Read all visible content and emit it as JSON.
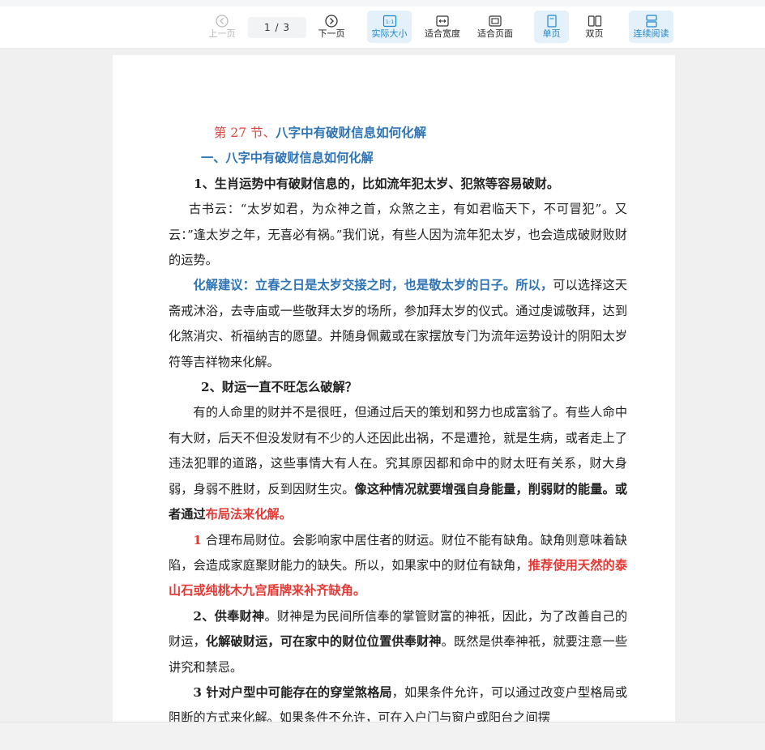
{
  "toolbar": {
    "prev": "上一页",
    "page_current": "1",
    "page_total": "/ 3",
    "next": "下一页",
    "actual_size": "实际大小",
    "fit_width": "适合宽度",
    "fit_page": "适合页面",
    "single": "单页",
    "double": "双页",
    "continuous": "连续阅读",
    "actual_icon_text": "1:1",
    "accent_color": "#1f86c9"
  },
  "doc": {
    "title_num": "第 27 节、",
    "title_rest": "八字中有破财信息如何化解",
    "h1": "一、八字中有破财信息如何化解",
    "h_shengxiao": "1、生肖运势中有破财信息的，比如流年犯太岁、犯煞等容易破财。",
    "p1": "古书云：“太岁如君，为众神之首，众煞之主，有如君临天下，不可冒犯”。又云：”逢太岁之年，无喜必有祸。”我们说，有些人因为流年犯太岁，也会造成破财败财的运势。",
    "p2_blue": "化解建议：立春之日是太岁交接之时，也是敬太岁的日子。所以，",
    "p2_rest": "可以选择这天斋戒沐浴，去寺庙或一些敬拜太岁的场所，参加拜太岁的仪式。通过虔诚敬拜，达到化煞消灾、祈福纳吉的愿望。并随身佩戴或在家摆放专门为流年运势设计的阴阳太岁符等吉祥物来化解。",
    "h2": "2、财运一直不旺怎么破解？",
    "p3": "有的人命里的财并不是很旺，但通过后天的策划和努力也成富翁了。有些人命中有大财，后天不但没发财有不少的人还因此出祸，不是遭抢，就是生病，或者走上了违法犯罪的道路，这些事情大有人在。究其原因都和命中的财太旺有关系，财大身弱，身弱不胜财，反到因财生灾。",
    "p3_bold": "像这种情况就要增强自身能量，削弱财的能量。或者通过",
    "p3_red": "布局法来化解。",
    "p4_num": "1",
    "p4_text": " 合理布局财位。会影响家中居住者的财运。财位不能有缺角。缺角则意味着缺陷，会造成家庭聚财能力的缺失。所以，如果家中的财位有缺角，",
    "p4_red": "推荐使用天然的泰山石或纯桃木九宫盾牌来补齐缺角。",
    "p5_bold1": "2、供奉财神",
    "p5_text1": "。财神是为民间所信奉的掌管财富的神祇，因此，为了改善自己的财运，",
    "p5_bold2": "化解破财运，可在家中的财位位置供奉财神",
    "p5_text2": "。既然是供奉神祇，就要注意一些讲究和禁忌。",
    "p6_bold": "3 针对户型中可能存在的穿堂煞格局",
    "p6_text": "，如果条件允许，可以通过改变户型格局或阻断的方式来化解。如果条件不允许，可在入户门与窗户或阳台之间摆"
  }
}
